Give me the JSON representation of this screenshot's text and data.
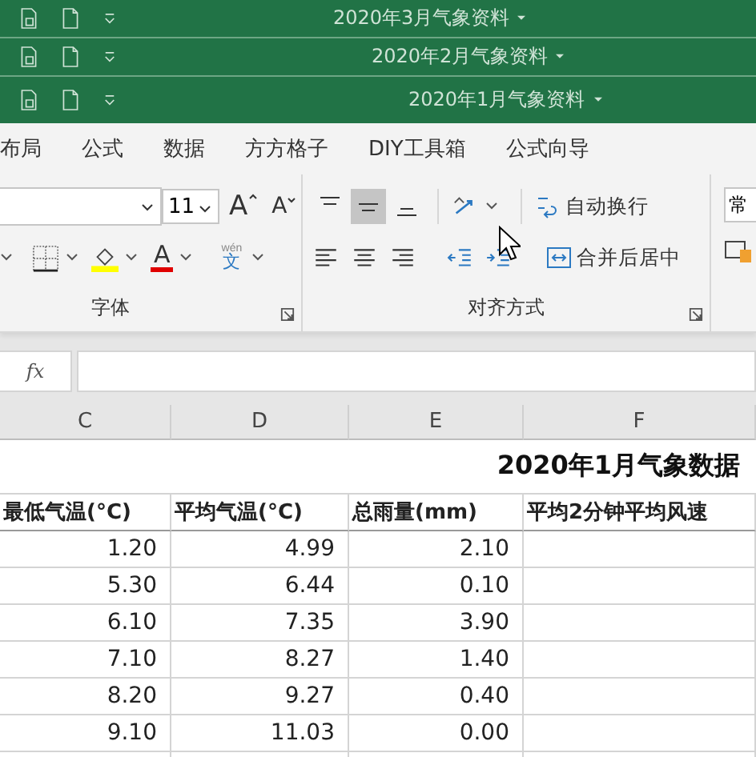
{
  "windows": [
    {
      "title": "2020年3月气象资料",
      "active": false
    },
    {
      "title": "2020年2月气象资料",
      "active": false
    },
    {
      "title": "2020年1月气象资料",
      "active": true
    }
  ],
  "ribbon_tabs": [
    {
      "label": "布局",
      "selected": false
    },
    {
      "label": "公式",
      "selected": false
    },
    {
      "label": "数据",
      "selected": false
    },
    {
      "label": "方方格子",
      "selected": false
    },
    {
      "label": "DIY工具箱",
      "selected": false
    },
    {
      "label": "公式向导",
      "selected": false
    }
  ],
  "ribbon": {
    "font_size": "11",
    "grow_font": "A",
    "shrink_font": "A",
    "font_color": "A",
    "phonetic_top": "wén",
    "phonetic_bottom": "文",
    "vertical_align": [
      {
        "kind": "top",
        "selected": false
      },
      {
        "kind": "middle",
        "selected": true
      },
      {
        "kind": "bottom",
        "selected": false
      }
    ],
    "wrap_text": "自动换行",
    "merge": "合并后居中",
    "number_format": "常",
    "groups": [
      "字体",
      "对齐方式"
    ]
  },
  "formula_bar": {
    "fx": "fx"
  },
  "sheet": {
    "columns": [
      "C",
      "D",
      "E",
      "F"
    ],
    "title": "2020年1月气象数据",
    "headers": [
      "最低气温(°C)",
      "平均气温(°C)",
      "总雨量(mm)",
      "平均2分钟平均风速"
    ],
    "rows": [
      [
        "1.20",
        "4.99",
        "2.10"
      ],
      [
        "5.30",
        "6.44",
        "0.10"
      ],
      [
        "6.10",
        "7.35",
        "3.90"
      ],
      [
        "7.10",
        "8.27",
        "1.40"
      ],
      [
        "8.20",
        "9.27",
        "0.40"
      ],
      [
        "9.10",
        "11.03",
        "0.00"
      ]
    ]
  }
}
